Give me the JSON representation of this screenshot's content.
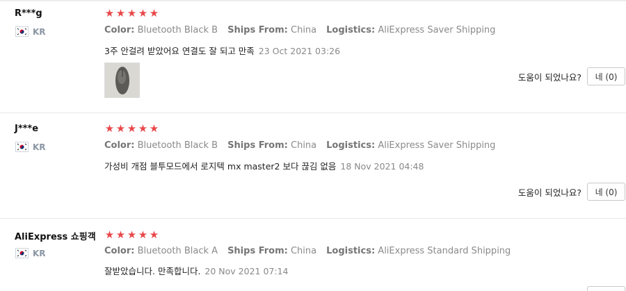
{
  "labels": {
    "color": "Color:",
    "ships_from": "Ships From:",
    "logistics": "Logistics:",
    "helpful_question": "도움이 되었나요?"
  },
  "reviews": [
    {
      "user": "R***g",
      "country": "KR",
      "rating": 5,
      "color": "Bluetooth Black B",
      "ships_from": "China",
      "logistics": "AliExpress Saver Shipping",
      "text": "3주 안걸려 받았어요 연결도 잘 되고 만족",
      "date": "23 Oct 2021 03:26",
      "helpful_button": "네 (0)"
    },
    {
      "user": "J***e",
      "country": "KR",
      "rating": 5,
      "color": "Bluetooth Black B",
      "ships_from": "China",
      "logistics": "AliExpress Saver Shipping",
      "text": "가성비 개점 블투모드에서 로지텍 mx master2 보다 끊김 없음",
      "date": "18 Nov 2021 04:48",
      "helpful_button": "네 (0)"
    },
    {
      "user": "AliExpress 쇼핑객",
      "country": "KR",
      "rating": 5,
      "color": "Bluetooth Black A",
      "ships_from": "China",
      "logistics": "AliExpress Standard Shipping",
      "text": "잘받았습니다. 만족합니다.",
      "date": "20 Nov 2021 07:14"
    }
  ],
  "colors": {
    "star": "#e8484a",
    "divider": "#e8e8e8",
    "meta_text": "#8a8a8a"
  },
  "icons": [
    "star-icon",
    "kr-flag-icon"
  ]
}
